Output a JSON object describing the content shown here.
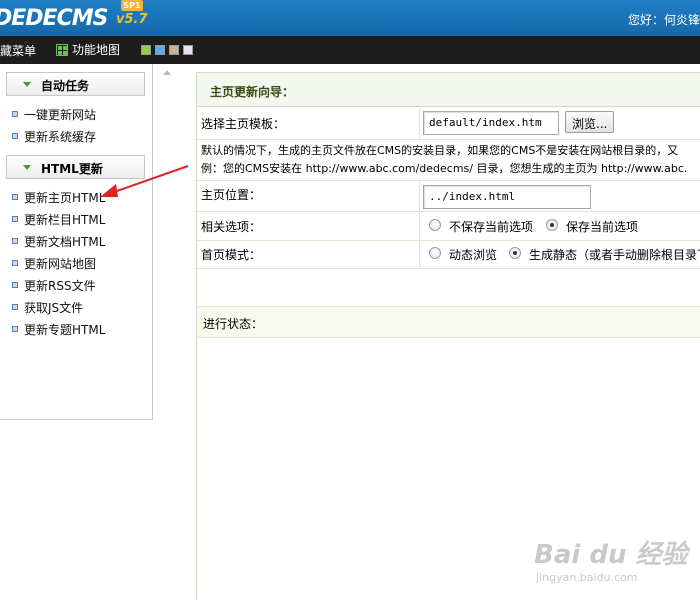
{
  "header": {
    "logo": "DEDECMS",
    "version": "v5.7",
    "badge": "SP1",
    "greeting": "您好：何炎锋"
  },
  "toolbar": {
    "hide_menu": "隐藏菜单",
    "site_map": "功能地图",
    "swatches": [
      "#8fd14f",
      "#5aaee6",
      "#c8b48a",
      "#e6e6e6"
    ]
  },
  "sidebar": {
    "groups": [
      {
        "title": "自动任务",
        "items": [
          "一键更新网站",
          "更新系统缓存"
        ]
      },
      {
        "title": "HTML更新",
        "items": [
          "更新主页HTML",
          "更新栏目HTML",
          "更新文档HTML",
          "更新网站地图",
          "更新RSS文件",
          "获取JS文件",
          "更新专题HTML"
        ]
      }
    ]
  },
  "main": {
    "title": "主页更新向导：",
    "template": {
      "label": "选择主页模板：",
      "value": "default/index.htm",
      "browse": "浏览..."
    },
    "description": [
      "默认的情况下，生成的主页文件放在CMS的安装目录，如果您的CMS不是安装在网站根目录的，又",
      "例：您的CMS安装在 http://www.abc.com/dedecms/ 目录，您想生成的主页为 http://www.abc."
    ],
    "position": {
      "label": "主页位置：",
      "value": "../index.html"
    },
    "options": {
      "label": "相关选项：",
      "choices": [
        "不保存当前选项",
        "保存当前选项"
      ],
      "selected": 1
    },
    "mode": {
      "label": "首页模式：",
      "choices": [
        "动态浏览",
        "生成静态（或者手动删除根目录下"
      ],
      "selected": 1
    },
    "status_label": "进行状态："
  },
  "watermark": {
    "main": "Bai du 经验",
    "sub": "jingyan.baidu.com"
  },
  "colors": {
    "header": "#1a72b8",
    "toolbar": "#1d1d1d",
    "annotation_arrow": "#e02222"
  }
}
